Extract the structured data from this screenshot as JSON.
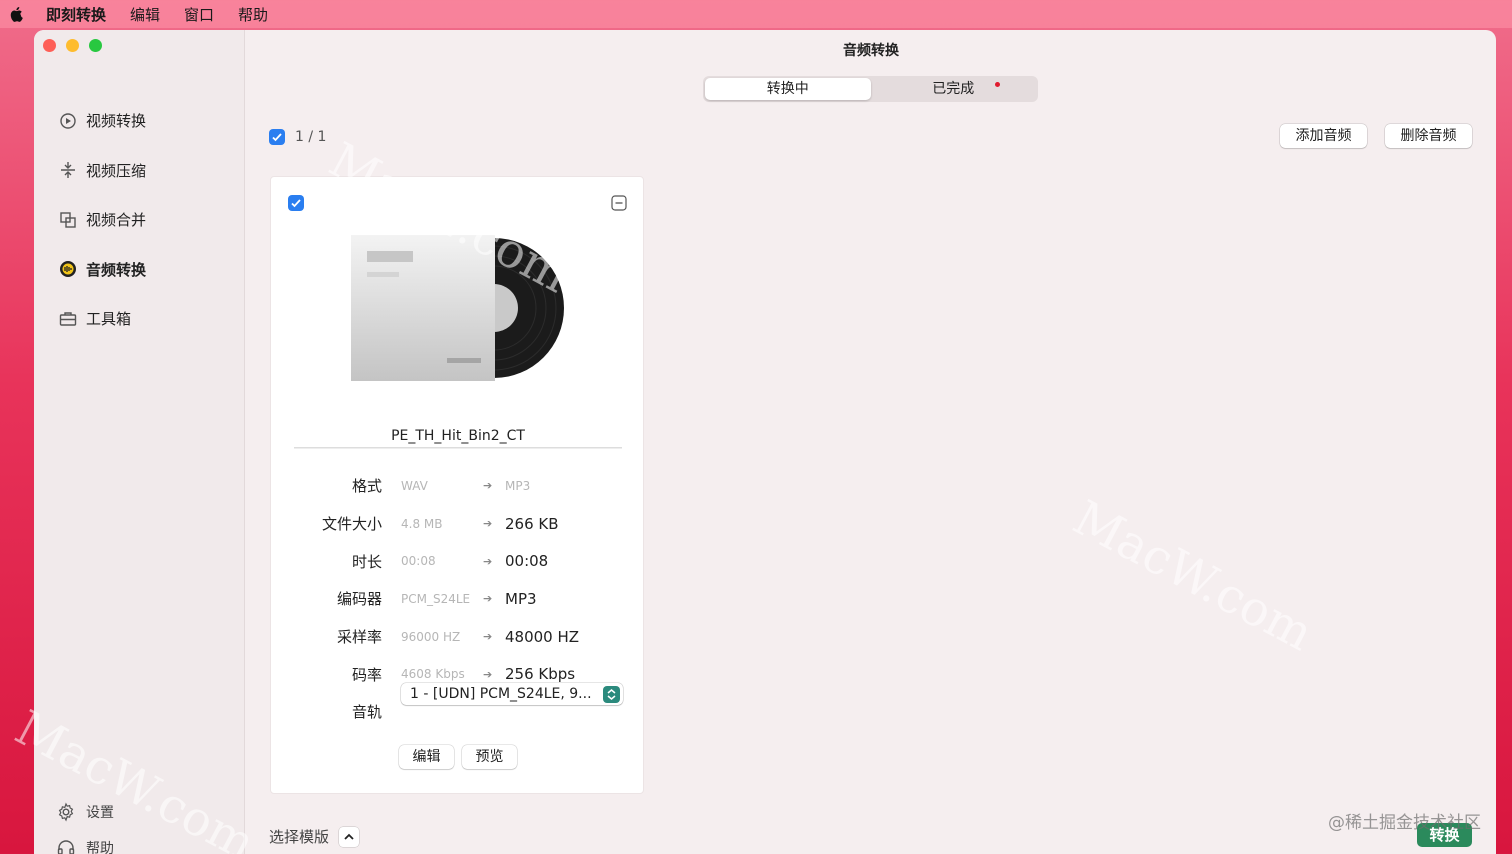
{
  "menubar": {
    "app_name": "即刻转换",
    "items": [
      "编辑",
      "窗口",
      "帮助"
    ]
  },
  "sidebar": {
    "items": [
      {
        "label": "视频转换",
        "icon": "video-convert-icon"
      },
      {
        "label": "视频压缩",
        "icon": "compress-icon"
      },
      {
        "label": "视频合并",
        "icon": "merge-icon"
      },
      {
        "label": "音频转换",
        "icon": "audio-convert-icon",
        "active": true
      },
      {
        "label": "工具箱",
        "icon": "toolbox-icon"
      }
    ],
    "settings_label": "设置",
    "help_label": "帮助"
  },
  "main": {
    "title": "音频转换",
    "tabs": [
      {
        "label": "转换中",
        "active": true
      },
      {
        "label": "已完成",
        "badge": true
      }
    ],
    "selection_count": "1 / 1",
    "add_audio_label": "添加音频",
    "delete_audio_label": "删除音频",
    "template_label": "选择模版",
    "convert_label": "转换"
  },
  "card": {
    "filename": "PE_TH_Hit_Bin2_CT",
    "properties": [
      {
        "label": "格式",
        "from": "WAV",
        "to": "MP3",
        "to_muted": true
      },
      {
        "label": "文件大小",
        "from": "4.8 MB",
        "to": "266 KB"
      },
      {
        "label": "时长",
        "from": "00:08",
        "to": "00:08"
      },
      {
        "label": "编码器",
        "from": "PCM_S24LE",
        "to": "MP3"
      },
      {
        "label": "采样率",
        "from": "96000 HZ",
        "to": "48000 HZ"
      },
      {
        "label": "码率",
        "from": "4608 Kbps",
        "to": "256 Kbps"
      }
    ],
    "track_label": "音轨",
    "track_value": "1 - [UDN] PCM_S24LE, 9...",
    "edit_label": "编辑",
    "preview_label": "预览"
  },
  "overlay": {
    "watermark": "MacW.com",
    "credit": "@稀土掘金技术社区"
  },
  "colors": {
    "accent": "#2a7ef0",
    "convert_button": "#2b8a5c",
    "badge": "#e01b2f"
  }
}
